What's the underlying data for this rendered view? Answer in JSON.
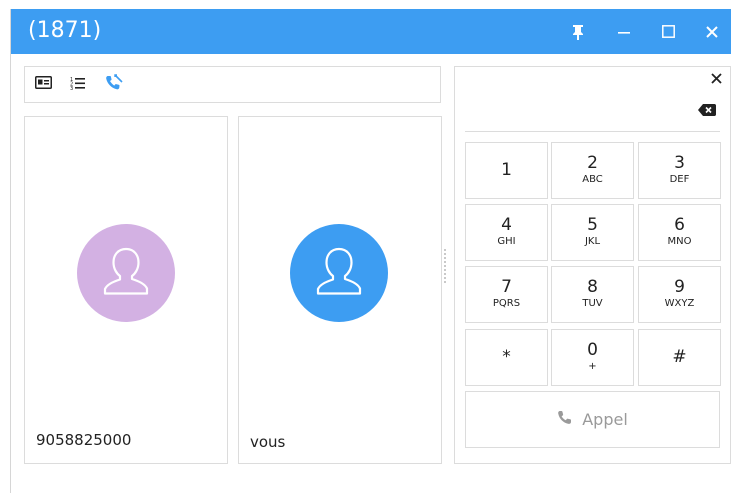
{
  "window": {
    "title": "(1871)",
    "accent_color": "#3d9df2",
    "controls": [
      "pin-icon",
      "minimize-icon",
      "maximize-icon",
      "close-icon"
    ]
  },
  "toolbar": {
    "icons": [
      "contact-card-icon",
      "numbered-list-icon",
      "missed-call-icon"
    ]
  },
  "participants": [
    {
      "label": "9058825000",
      "avatar_color": "#d3b1e3",
      "icon": "user-silhouette-icon"
    },
    {
      "label": "vous",
      "avatar_color": "#3d9df2",
      "icon": "user-silhouette-icon"
    }
  ],
  "dialer": {
    "number_value": "",
    "keys": [
      {
        "digit": "1",
        "letters": ""
      },
      {
        "digit": "2",
        "letters": "ABC"
      },
      {
        "digit": "3",
        "letters": "DEF"
      },
      {
        "digit": "4",
        "letters": "GHI"
      },
      {
        "digit": "5",
        "letters": "JKL"
      },
      {
        "digit": "6",
        "letters": "MNO"
      },
      {
        "digit": "7",
        "letters": "PQRS"
      },
      {
        "digit": "8",
        "letters": "TUV"
      },
      {
        "digit": "9",
        "letters": "WXYZ"
      },
      {
        "digit": "*",
        "letters": ""
      },
      {
        "digit": "0",
        "letters": "+"
      },
      {
        "digit": "#",
        "letters": ""
      }
    ],
    "call_label": "Appel"
  }
}
